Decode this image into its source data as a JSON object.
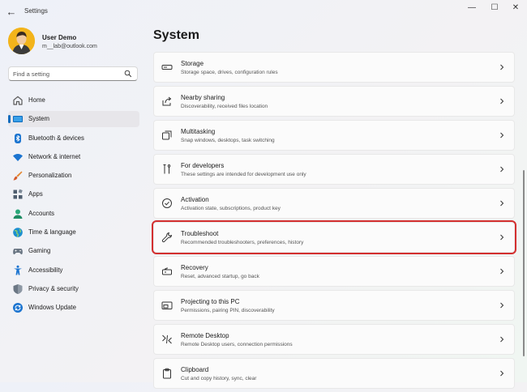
{
  "app": {
    "title": "Settings"
  },
  "user": {
    "name": "User Demo",
    "email": "m__lab@outlook.com"
  },
  "search": {
    "placeholder": "Find a setting"
  },
  "nav": [
    {
      "label": "Home",
      "icon": "home-icon",
      "color": "#5a5a5a"
    },
    {
      "label": "System",
      "icon": "system-icon",
      "color": "#0f6cbd",
      "selected": true
    },
    {
      "label": "Bluetooth & devices",
      "icon": "bluetooth-icon",
      "color": "#1b74d0"
    },
    {
      "label": "Network & internet",
      "icon": "wifi-icon",
      "color": "#1b74d0"
    },
    {
      "label": "Personalization",
      "icon": "brush-icon",
      "color": "#e3852d"
    },
    {
      "label": "Apps",
      "icon": "apps-icon",
      "color": "#4e5d6e"
    },
    {
      "label": "Accounts",
      "icon": "accounts-icon",
      "color": "#2aa879"
    },
    {
      "label": "Time & language",
      "icon": "globe-icon",
      "color": "#1b8fd0"
    },
    {
      "label": "Gaming",
      "icon": "gamepad-icon",
      "color": "#6b7784"
    },
    {
      "label": "Accessibility",
      "icon": "accessibility-icon",
      "color": "#1b74d0"
    },
    {
      "label": "Privacy & security",
      "icon": "shield-icon",
      "color": "#6b7784"
    },
    {
      "label": "Windows Update",
      "icon": "update-icon",
      "color": "#1b74d0"
    }
  ],
  "main": {
    "title": "System",
    "items": [
      {
        "title": "Storage",
        "subtitle": "Storage space, drives, configuration rules",
        "icon": "storage-icon"
      },
      {
        "title": "Nearby sharing",
        "subtitle": "Discoverability, received files location",
        "icon": "nearby-sharing-icon"
      },
      {
        "title": "Multitasking",
        "subtitle": "Snap windows, desktops, task switching",
        "icon": "multitasking-icon"
      },
      {
        "title": "For developers",
        "subtitle": "These settings are intended for development use only",
        "icon": "developers-icon"
      },
      {
        "title": "Activation",
        "subtitle": "Activation state, subscriptions, product key",
        "icon": "activation-icon"
      },
      {
        "title": "Troubleshoot",
        "subtitle": "Recommended troubleshooters, preferences, history",
        "icon": "wrench-icon",
        "highlighted": true
      },
      {
        "title": "Recovery",
        "subtitle": "Reset, advanced startup, go back",
        "icon": "recovery-icon"
      },
      {
        "title": "Projecting to this PC",
        "subtitle": "Permissions, pairing PIN, discoverability",
        "icon": "projecting-icon"
      },
      {
        "title": "Remote Desktop",
        "subtitle": "Remote Desktop users, connection permissions",
        "icon": "remote-desktop-icon"
      },
      {
        "title": "Clipboard",
        "subtitle": "Cut and copy history, sync, clear",
        "icon": "clipboard-icon"
      }
    ]
  },
  "colors": {
    "accent": "#0f6cbd",
    "highlight_border": "#d32f2f"
  }
}
